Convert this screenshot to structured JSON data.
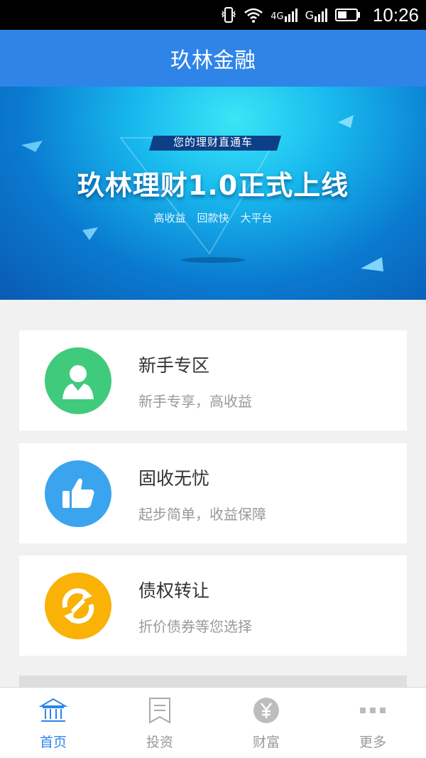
{
  "status_bar": {
    "time": "10:26",
    "net_4g": "4G",
    "net_g": "G"
  },
  "header": {
    "title": "玖林金融"
  },
  "banner": {
    "tag": "您的理财直通车",
    "headline": "玖林理财1.0正式上线",
    "features": [
      "高收益",
      "回款快",
      "大平台"
    ]
  },
  "cards": [
    {
      "title": "新手专区",
      "desc": "新手专享，高收益",
      "icon": "user-icon",
      "color": "#3fca7c"
    },
    {
      "title": "固收无忧",
      "desc": "起步简单，收益保障",
      "icon": "thumbs-up-icon",
      "color": "#3aa4ef"
    },
    {
      "title": "债权转让",
      "desc": "折价债券等您选择",
      "icon": "exchange-icon",
      "color": "#f9b205"
    }
  ],
  "tabs": [
    {
      "label": "首页",
      "icon": "bank-icon",
      "active": true
    },
    {
      "label": "投资",
      "icon": "bookmark-icon",
      "active": false
    },
    {
      "label": "财富",
      "icon": "yen-icon",
      "active": false
    },
    {
      "label": "更多",
      "icon": "more-icon",
      "active": false
    }
  ],
  "colors": {
    "primary": "#2f84e8",
    "inactive": "#999999"
  }
}
